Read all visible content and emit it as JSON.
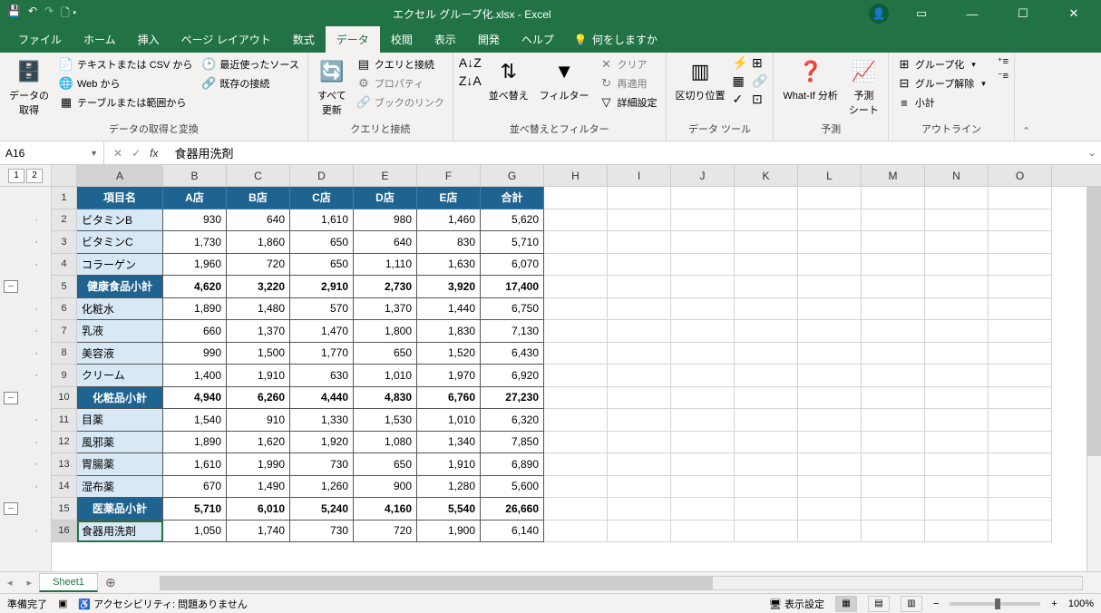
{
  "title": "エクセル グループ化.xlsx  -  Excel",
  "menus": [
    "ファイル",
    "ホーム",
    "挿入",
    "ページ レイアウト",
    "数式",
    "データ",
    "校閲",
    "表示",
    "開発",
    "ヘルプ"
  ],
  "menu_active": 5,
  "tellme": "何をしますか",
  "ribbon": {
    "g1": {
      "label": "データの取得と変換",
      "get": "データの\n取得",
      "csv": "テキストまたは CSV から",
      "web": "Web から",
      "table": "テーブルまたは範囲から",
      "recent": "最近使ったソース",
      "existing": "既存の接続"
    },
    "g2": {
      "label": "クエリと接続",
      "refresh": "すべて\n更新",
      "qc": "クエリと接続",
      "prop": "プロパティ",
      "link": "ブックのリンク"
    },
    "g3": {
      "label": "並べ替えとフィルター",
      "sort": "並べ替え",
      "filter": "フィルター",
      "clear": "クリア",
      "reapply": "再適用",
      "advanced": "詳細設定"
    },
    "g4": {
      "label": "データ ツール",
      "split": "区切り位置"
    },
    "g5": {
      "label": "予測",
      "whatif": "What-If 分析",
      "forecast": "予測\nシート"
    },
    "g6": {
      "label": "アウトライン",
      "group": "グループ化",
      "ungroup": "グループ解除",
      "subtotal": "小計"
    }
  },
  "namebox": "A16",
  "formula": "食器用洗剤",
  "outline_levels": [
    "1",
    "2"
  ],
  "cols": [
    {
      "l": "A",
      "w": 95
    },
    {
      "l": "B",
      "w": 70
    },
    {
      "l": "C",
      "w": 70
    },
    {
      "l": "D",
      "w": 70
    },
    {
      "l": "E",
      "w": 70
    },
    {
      "l": "F",
      "w": 70
    },
    {
      "l": "G",
      "w": 70
    },
    {
      "l": "H",
      "w": 70
    },
    {
      "l": "I",
      "w": 70
    },
    {
      "l": "J",
      "w": 70
    },
    {
      "l": "K",
      "w": 70
    },
    {
      "l": "L",
      "w": 70
    },
    {
      "l": "M",
      "w": 70
    },
    {
      "l": "N",
      "w": 70
    },
    {
      "l": "O",
      "w": 70
    }
  ],
  "header_row": [
    "項目名",
    "A店",
    "B店",
    "C店",
    "D店",
    "E店",
    "合計"
  ],
  "rows": [
    {
      "n": 2,
      "t": "d",
      "label": "ビタミンB",
      "v": [
        "930",
        "640",
        "1,610",
        "980",
        "1,460",
        "5,620"
      ]
    },
    {
      "n": 3,
      "t": "d",
      "label": "ビタミンC",
      "v": [
        "1,730",
        "1,860",
        "650",
        "640",
        "830",
        "5,710"
      ]
    },
    {
      "n": 4,
      "t": "d",
      "label": "コラーゲン",
      "v": [
        "1,960",
        "720",
        "650",
        "1,110",
        "1,630",
        "6,070"
      ]
    },
    {
      "n": 5,
      "t": "s",
      "label": "健康食品小計",
      "v": [
        "4,620",
        "3,220",
        "2,910",
        "2,730",
        "3,920",
        "17,400"
      ]
    },
    {
      "n": 6,
      "t": "d",
      "label": "化粧水",
      "v": [
        "1,890",
        "1,480",
        "570",
        "1,370",
        "1,440",
        "6,750"
      ]
    },
    {
      "n": 7,
      "t": "d",
      "label": "乳液",
      "v": [
        "660",
        "1,370",
        "1,470",
        "1,800",
        "1,830",
        "7,130"
      ]
    },
    {
      "n": 8,
      "t": "d",
      "label": "美容液",
      "v": [
        "990",
        "1,500",
        "1,770",
        "650",
        "1,520",
        "6,430"
      ]
    },
    {
      "n": 9,
      "t": "d",
      "label": "クリーム",
      "v": [
        "1,400",
        "1,910",
        "630",
        "1,010",
        "1,970",
        "6,920"
      ]
    },
    {
      "n": 10,
      "t": "s",
      "label": "化粧品小計",
      "v": [
        "4,940",
        "6,260",
        "4,440",
        "4,830",
        "6,760",
        "27,230"
      ]
    },
    {
      "n": 11,
      "t": "d",
      "label": "目薬",
      "v": [
        "1,540",
        "910",
        "1,330",
        "1,530",
        "1,010",
        "6,320"
      ]
    },
    {
      "n": 12,
      "t": "d",
      "label": "風邪薬",
      "v": [
        "1,890",
        "1,620",
        "1,920",
        "1,080",
        "1,340",
        "7,850"
      ]
    },
    {
      "n": 13,
      "t": "d",
      "label": "胃腸薬",
      "v": [
        "1,610",
        "1,990",
        "730",
        "650",
        "1,910",
        "6,890"
      ]
    },
    {
      "n": 14,
      "t": "d",
      "label": "湿布薬",
      "v": [
        "670",
        "1,490",
        "1,260",
        "900",
        "1,280",
        "5,600"
      ]
    },
    {
      "n": 15,
      "t": "s",
      "label": "医薬品小計",
      "v": [
        "5,710",
        "6,010",
        "5,240",
        "4,160",
        "5,540",
        "26,660"
      ]
    },
    {
      "n": 16,
      "t": "d",
      "label": "食器用洗剤",
      "v": [
        "1,050",
        "1,740",
        "730",
        "720",
        "1,900",
        "6,140"
      ],
      "active": true
    }
  ],
  "outline_marks": {
    "2": "·",
    "3": "·",
    "4": "·",
    "5": "-",
    "6": "·",
    "7": "·",
    "8": "·",
    "9": "·",
    "10": "-",
    "11": "·",
    "12": "·",
    "13": "·",
    "14": "·",
    "15": "-",
    "16": "·"
  },
  "sheet_tab": "Sheet1",
  "status": {
    "ready": "準備完了",
    "access": "アクセシビリティ: 問題ありません",
    "display": "表示設定",
    "zoom": "100%"
  }
}
